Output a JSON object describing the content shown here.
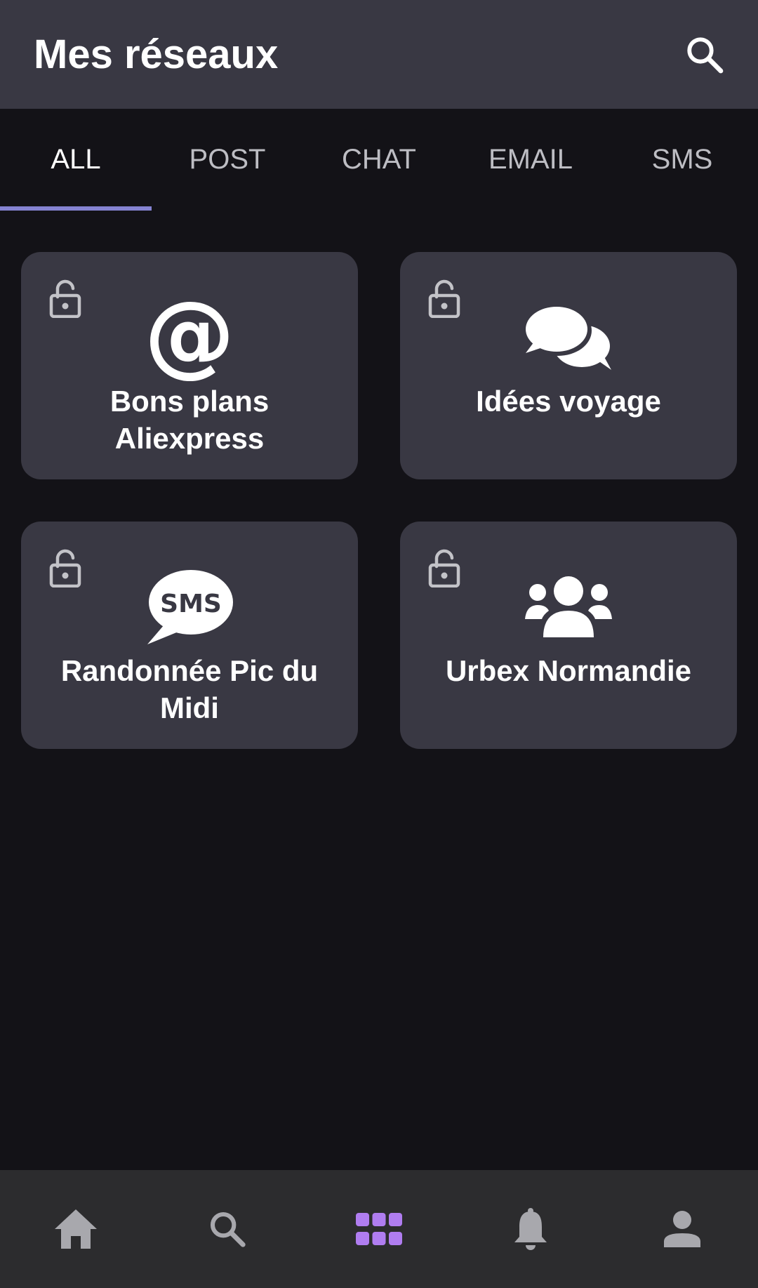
{
  "header": {
    "title": "Mes réseaux",
    "search_icon": "search-icon"
  },
  "tabs": [
    {
      "label": "ALL",
      "active": true
    },
    {
      "label": "POST",
      "active": false
    },
    {
      "label": "CHAT",
      "active": false
    },
    {
      "label": "EMAIL",
      "active": false
    },
    {
      "label": "SMS",
      "active": false
    }
  ],
  "cards": [
    {
      "title": "Bons plans Aliexpress",
      "type_icon": "at-icon",
      "lock_icon": "lock-open-icon"
    },
    {
      "title": "Idées voyage",
      "type_icon": "chat-bubbles-icon",
      "lock_icon": "lock-open-icon"
    },
    {
      "title": "Randonnée Pic du Midi",
      "type_icon": "sms-bubble-icon",
      "lock_icon": "lock-open-icon"
    },
    {
      "title": "Urbex Normandie",
      "type_icon": "group-icon",
      "lock_icon": "lock-open-icon"
    }
  ],
  "bottom_nav": [
    {
      "icon": "home-icon",
      "active": false
    },
    {
      "icon": "search-icon",
      "active": false
    },
    {
      "icon": "grid-icon",
      "active": true
    },
    {
      "icon": "bell-icon",
      "active": false
    },
    {
      "icon": "profile-icon",
      "active": false
    }
  ],
  "colors": {
    "background": "#131217",
    "surface": "#393843",
    "nav_background": "#2c2c2e",
    "accent": "#8583d2",
    "active_nav": "#b07df0",
    "inactive_icon": "#a8a8ad",
    "inactive_tab": "#bdbdc3"
  }
}
